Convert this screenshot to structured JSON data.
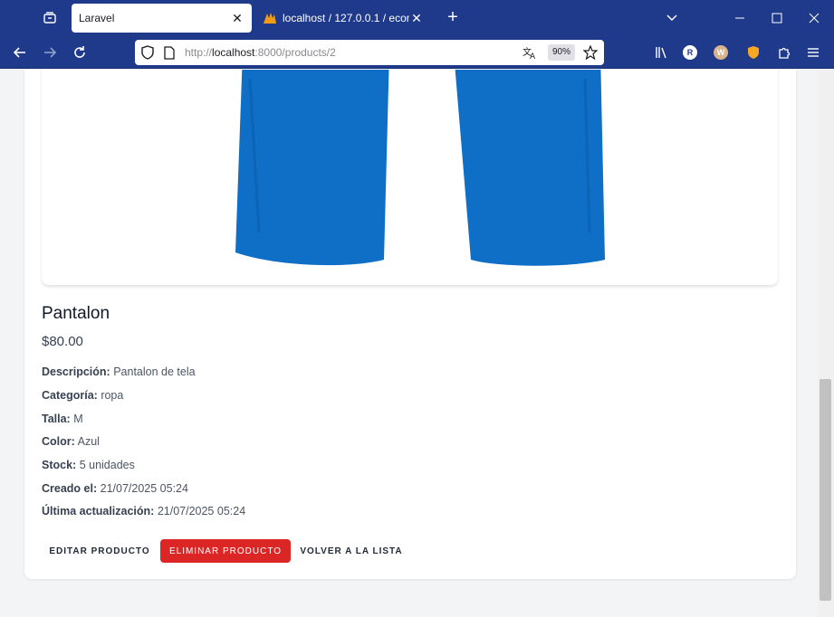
{
  "browser": {
    "active_tab_title": "Laravel",
    "inactive_tab_title": "localhost / 127.0.0.1 / ecommerce",
    "url_prefix": "http://",
    "url_host": "localhost",
    "url_rest": ":8000/products/2",
    "zoom": "90%",
    "accent": "#1f3a8a",
    "ext_r": "R",
    "ext_w": "W"
  },
  "product": {
    "name": "Pantalon",
    "price": "$80.00",
    "details": [
      {
        "label": "Descripción:",
        "value": "Pantalon de tela"
      },
      {
        "label": "Categoría:",
        "value": "ropa"
      },
      {
        "label": "Talla:",
        "value": "M"
      },
      {
        "label": "Color:",
        "value": "Azul"
      },
      {
        "label": "Stock:",
        "value": "5 unidades"
      },
      {
        "label": "Creado el:",
        "value": "21/07/2025 05:24"
      },
      {
        "label": "Última actualización:",
        "value": "21/07/2025 05:24"
      }
    ]
  },
  "actions": {
    "edit": "EDITAR PRODUCTO",
    "delete": "ELIMINAR PRODUCTO",
    "back": "VOLVER A LA LISTA",
    "delete_color": "#dc2626"
  }
}
